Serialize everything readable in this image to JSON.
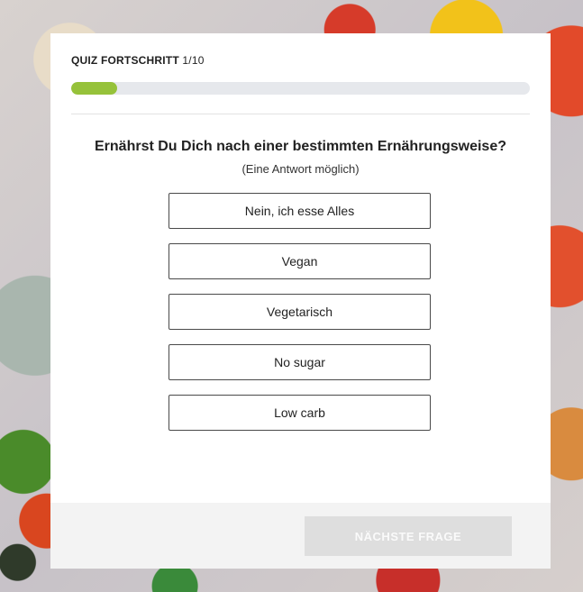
{
  "quiz": {
    "progress_title": "QUIZ FORTSCHRITT",
    "progress_count": "1/10",
    "progress_fraction": 0.1,
    "progress_color": "#96c23a",
    "question": "Ernährst Du Dich nach einer bestimmten Ernährungsweise?",
    "hint": "(Eine Antwort möglich)",
    "options": [
      {
        "label": "Nein, ich esse Alles"
      },
      {
        "label": "Vegan"
      },
      {
        "label": "Vegetarisch"
      },
      {
        "label": "No sugar"
      },
      {
        "label": "Low carb"
      }
    ],
    "next_label": "NÄCHSTE FRAGE"
  }
}
